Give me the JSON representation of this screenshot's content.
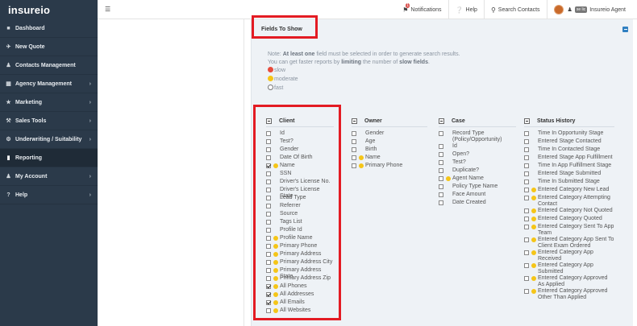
{
  "brand": {
    "logo_text": "insureio"
  },
  "sidebar": {
    "items": [
      {
        "label": "Dashboard",
        "icon": "dashboard-icon"
      },
      {
        "label": "New Quote",
        "icon": "plane-icon"
      },
      {
        "label": "Contacts Management",
        "icon": "users-icon"
      },
      {
        "label": "Agency Management",
        "icon": "sitemap-icon"
      },
      {
        "label": "Marketing",
        "icon": "bullhorn-icon"
      },
      {
        "label": "Sales Tools",
        "icon": "wrench-icon"
      },
      {
        "label": "Underwriting / Suitability",
        "icon": "cogs-icon"
      },
      {
        "label": "Reporting",
        "icon": "bar-chart-icon"
      },
      {
        "label": "My Account",
        "icon": "user-icon"
      },
      {
        "label": "Help",
        "icon": "question-icon"
      }
    ]
  },
  "topbar": {
    "notifications_label": "Notifications",
    "notifications_count": "1",
    "help_label": "Help",
    "search_label": "Search Contacts",
    "user_tag": "se lic",
    "user_name": "Insureio Agent"
  },
  "panel": {
    "title": "Fields To Show",
    "note_prefix": "Note: ",
    "note_bold1": "At least one",
    "note_mid1": " field must be selected in order to generate search results.",
    "note_line2a": "You can get faster reports by ",
    "note_bold2": "limiting",
    "note_line2b": " the number of ",
    "note_bold3": "slow fields",
    "note_line2c": ".",
    "legend": {
      "slow": "slow",
      "moderate": "moderate",
      "fast": "fast"
    }
  },
  "columns": {
    "client": {
      "title": "Client",
      "items": [
        {
          "label": "Id",
          "checked": false,
          "dot": false
        },
        {
          "label": "Test?",
          "checked": false,
          "dot": false
        },
        {
          "label": "Gender",
          "checked": false,
          "dot": false
        },
        {
          "label": "Date Of Birth",
          "checked": false,
          "dot": false
        },
        {
          "label": "Name",
          "checked": true,
          "dot": true
        },
        {
          "label": "SSN",
          "checked": false,
          "dot": false
        },
        {
          "label": "Driver's License No.",
          "checked": false,
          "dot": false
        },
        {
          "label": "Driver's License State",
          "checked": false,
          "dot": false
        },
        {
          "label": "Lead Type",
          "checked": false,
          "dot": false
        },
        {
          "label": "Referrer",
          "checked": false,
          "dot": false
        },
        {
          "label": "Source",
          "checked": false,
          "dot": false
        },
        {
          "label": "Tags List",
          "checked": false,
          "dot": false
        },
        {
          "label": "Profile Id",
          "checked": false,
          "dot": false
        },
        {
          "label": "Profile Name",
          "checked": false,
          "dot": true
        },
        {
          "label": "Primary Phone",
          "checked": false,
          "dot": true
        },
        {
          "label": "Primary Address",
          "checked": false,
          "dot": true
        },
        {
          "label": "Primary Address City",
          "checked": false,
          "dot": true
        },
        {
          "label": "Primary Address State",
          "checked": false,
          "dot": true
        },
        {
          "label": "Primary Address Zip",
          "checked": false,
          "dot": true
        },
        {
          "label": "All Phones",
          "checked": true,
          "dot": true
        },
        {
          "label": "All Addresses",
          "checked": true,
          "dot": true
        },
        {
          "label": "All Emails",
          "checked": true,
          "dot": true
        },
        {
          "label": "All Websites",
          "checked": false,
          "dot": true
        }
      ]
    },
    "owner": {
      "title": "Owner",
      "items": [
        {
          "label": "Gender",
          "checked": false,
          "dot": false
        },
        {
          "label": "Age",
          "checked": false,
          "dot": false
        },
        {
          "label": "Birth",
          "checked": false,
          "dot": false
        },
        {
          "label": "Name",
          "checked": false,
          "dot": true
        },
        {
          "label": "Primary Phone",
          "checked": false,
          "dot": true
        }
      ]
    },
    "case": {
      "title": "Case",
      "items": [
        {
          "label": "Record Type (Policy/Opportunity)",
          "checked": false,
          "dot": false,
          "wrap": true
        },
        {
          "label": "Id",
          "checked": false,
          "dot": false
        },
        {
          "label": "Open?",
          "checked": false,
          "dot": false
        },
        {
          "label": "Test?",
          "checked": false,
          "dot": false
        },
        {
          "label": "Duplicate?",
          "checked": false,
          "dot": false
        },
        {
          "label": "Agent Name",
          "checked": false,
          "dot": true
        },
        {
          "label": "Policy Type Name",
          "checked": false,
          "dot": false
        },
        {
          "label": "Face Amount",
          "checked": false,
          "dot": false
        },
        {
          "label": "Date Created",
          "checked": false,
          "dot": false
        }
      ]
    },
    "status": {
      "title": "Status History",
      "items": [
        {
          "label": "Time In Opportunity Stage",
          "checked": false,
          "dot": false
        },
        {
          "label": "Entered Stage Contacted",
          "checked": false,
          "dot": false
        },
        {
          "label": "Time In Contacted Stage",
          "checked": false,
          "dot": false
        },
        {
          "label": "Entered Stage App Fulfillment",
          "checked": false,
          "dot": false
        },
        {
          "label": "Time In App Fulfillment Stage",
          "checked": false,
          "dot": false
        },
        {
          "label": "Entered Stage Submitted",
          "checked": false,
          "dot": false
        },
        {
          "label": "Time In Submitted Stage",
          "checked": false,
          "dot": false
        },
        {
          "label": "Entered Category New Lead",
          "checked": false,
          "dot": true
        },
        {
          "label": "Entered Category Attempting Contact",
          "checked": false,
          "dot": true,
          "wrap": true
        },
        {
          "label": "Entered Category Not Quoted",
          "checked": false,
          "dot": true
        },
        {
          "label": "Entered Category Quoted",
          "checked": false,
          "dot": true
        },
        {
          "label": "Entered Category Sent To App Team",
          "checked": false,
          "dot": true,
          "wrap": true
        },
        {
          "label": "Entered Category App Sent To Client Exam Ordered",
          "checked": false,
          "dot": true,
          "wrap": true
        },
        {
          "label": "Entered Category App Received",
          "checked": false,
          "dot": true,
          "wrap": true
        },
        {
          "label": "Entered Category App Submitted",
          "checked": false,
          "dot": true,
          "wrap": true
        },
        {
          "label": "Entered Category Approved As Applied",
          "checked": false,
          "dot": true,
          "wrap": true
        },
        {
          "label": "Entered Category Approved Other Than Applied",
          "checked": false,
          "dot": true,
          "wrap": true
        }
      ]
    }
  }
}
